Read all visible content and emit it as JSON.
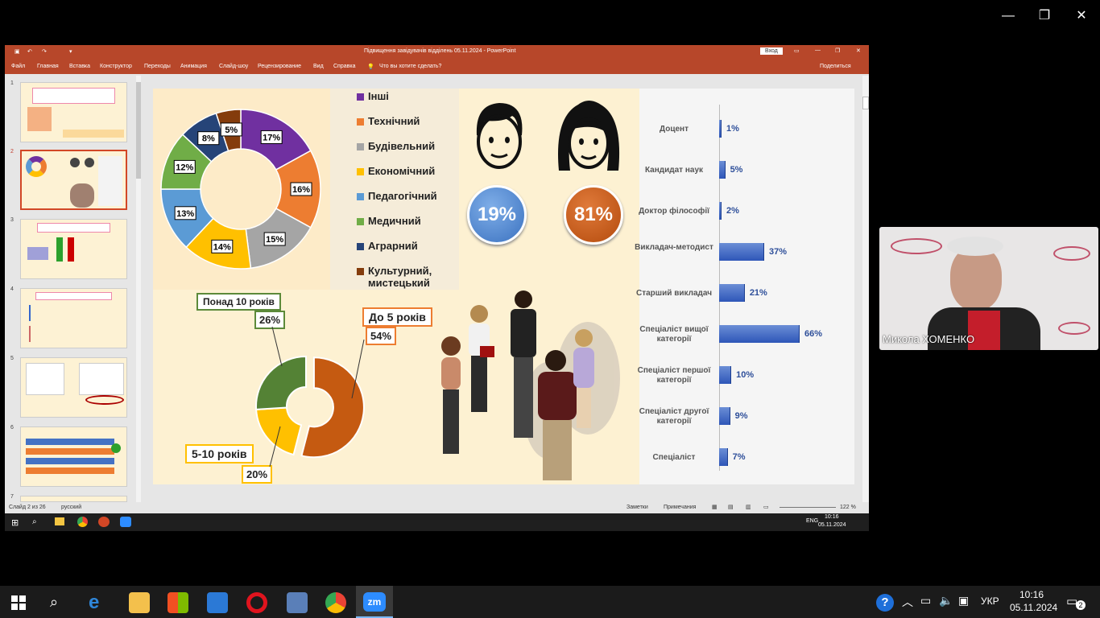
{
  "zoom_window": {
    "controls": [
      "—",
      "❐",
      "✕"
    ]
  },
  "ppt": {
    "title": "Підвищення завідувачів відділень 05.11.2024 - PowerPoint",
    "login_button": "Вход",
    "ribbon_tabs": [
      "Файл",
      "Главная",
      "Вставка",
      "Конструктор",
      "Переходы",
      "Анимация",
      "Слайд-шоу",
      "Рецензирование",
      "Вид",
      "Справка"
    ],
    "tell_me": "Что вы хотите сделать?",
    "share": "Поделиться",
    "slide_numbers": [
      "1",
      "2",
      "3",
      "4",
      "5",
      "6",
      "7"
    ],
    "status": {
      "slide_of": "Слайд 2 из 26",
      "language": "русский",
      "notes": "Заметки",
      "comments": "Примечания",
      "zoom": "122 %"
    },
    "taskbar_time": "10:16",
    "taskbar_date": "05.11.2024",
    "taskbar_lang": "ENG"
  },
  "slide": {
    "legend": [
      {
        "label": "Інші",
        "color": "#7030a0"
      },
      {
        "label": "Технічний",
        "color": "#ed7d31"
      },
      {
        "label": "Будівельний",
        "color": "#a5a5a5"
      },
      {
        "label": "Економічний",
        "color": "#ffc000"
      },
      {
        "label": "Педагогічний",
        "color": "#5b9bd5"
      },
      {
        "label": "Медичний",
        "color": "#70ad47"
      },
      {
        "label": "Аграрний",
        "color": "#264478"
      },
      {
        "label": "Культурний, мистецький",
        "color": "#843c0c"
      }
    ],
    "gender": {
      "male": "19%",
      "female": "81%"
    },
    "experience": [
      {
        "label": "Понад 10 років",
        "value": "26%"
      },
      {
        "label": "До 5 років",
        "value": "54%"
      },
      {
        "label": "5-10 років",
        "value": "20%"
      }
    ]
  },
  "chart_data": [
    {
      "type": "pie",
      "categories": [
        "Інші",
        "Технічний",
        "Будівельний",
        "Економічний",
        "Педагогічний",
        "Медичний",
        "Аграрний",
        "Культурний, мистецький"
      ],
      "values": [
        17,
        16,
        15,
        14,
        13,
        12,
        8,
        5
      ],
      "labels": [
        "17%",
        "16%",
        "15%",
        "14%",
        "13%",
        "12%",
        "8%",
        "5%"
      ]
    },
    {
      "type": "pie",
      "categories": [
        "До 5 років",
        "5-10 років",
        "Понад 10 років"
      ],
      "values": [
        54,
        20,
        26
      ]
    },
    {
      "type": "bar",
      "categories": [
        "Доцент",
        "Кандидат наук",
        "Доктор філософії",
        "Викладач-методист",
        "Старший викладач",
        "Спеціаліст вищої категорії",
        "Спеціаліст першої категорії",
        "Спеціаліст другої категорії",
        "Спеціаліст"
      ],
      "values": [
        1,
        5,
        2,
        37,
        21,
        66,
        10,
        9,
        7
      ],
      "labels": [
        "1%",
        "5%",
        "2%",
        "37%",
        "21%",
        "66%",
        "10%",
        "9%",
        "7%"
      ]
    }
  ],
  "video": {
    "name": "Микола ХОМЕНКО"
  },
  "taskbar": {
    "time": "10:16",
    "date": "05.11.2024",
    "lang": "УКР",
    "notifications": "2"
  }
}
